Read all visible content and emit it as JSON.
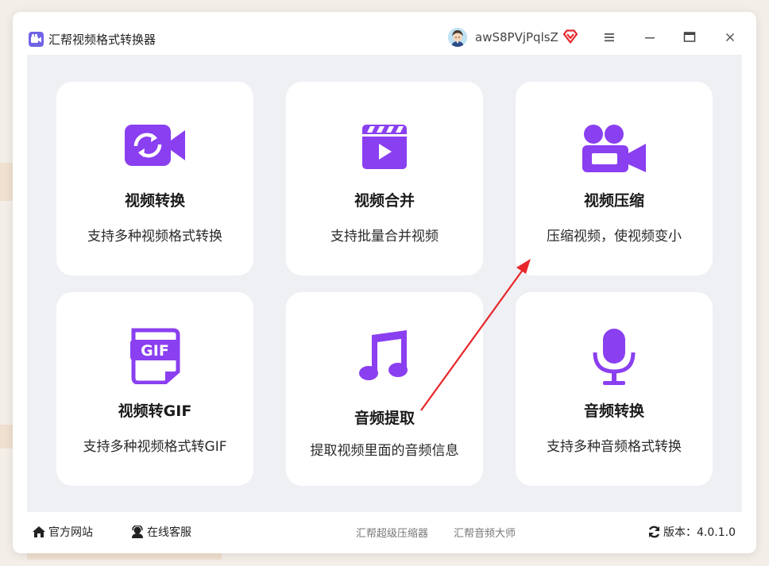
{
  "app": {
    "title": "汇帮视频格式转换器",
    "username": "awS8PVjPqlsZ"
  },
  "cards": [
    {
      "title": "视频转换",
      "desc": "支持多种视频格式转换",
      "icon": "video-convert-icon"
    },
    {
      "title": "视频合并",
      "desc": "支持批量合并视频",
      "icon": "video-merge-icon"
    },
    {
      "title": "视频压缩",
      "desc": "压缩视频，使视频变小",
      "icon": "video-camera-icon"
    },
    {
      "title": "视频转GIF",
      "desc": "支持多种视频格式转GIF",
      "icon": "gif-icon"
    },
    {
      "title": "音频提取",
      "desc": "提取视频里面的音频信息",
      "icon": "music-note-icon"
    },
    {
      "title": "音频转换",
      "desc": "支持多种音频格式转换",
      "icon": "microphone-icon"
    }
  ],
  "footer": {
    "website": "官方网站",
    "support": "在线客服",
    "link1": "汇帮超级压缩器",
    "link2": "汇帮音频大师",
    "version": "版本：4.0.1.0"
  },
  "colors": {
    "accent": "#8a3ff0",
    "annotation_arrow": "#e8262a"
  }
}
